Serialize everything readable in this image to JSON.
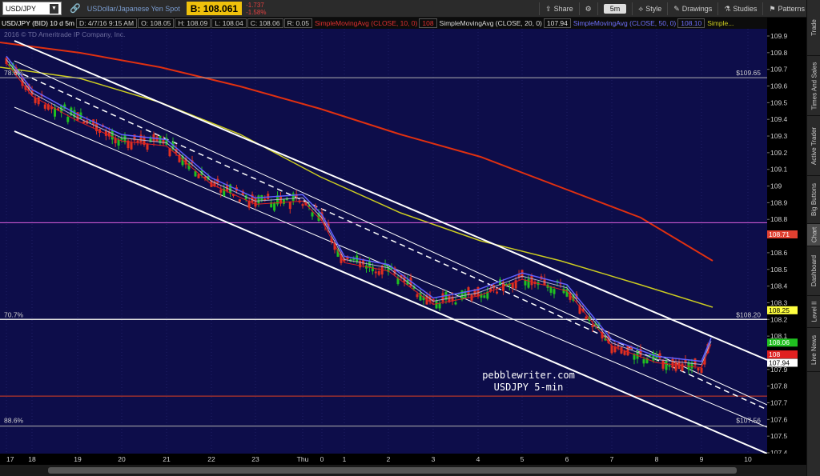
{
  "toolbar": {
    "symbol": "USD/JPY",
    "description": "USDollar/Japanese Yen Spot",
    "bid_label": "B: 108.061",
    "change": "-1.737",
    "change_pct": "-1.58%",
    "share": "Share",
    "timeframe": "5m",
    "style": "Style",
    "drawings": "Drawings",
    "studies": "Studies",
    "patterns": "Patterns"
  },
  "study_line": {
    "instrument": "USD/JPY (BID) 10 d 5m",
    "date": "D: 4/7/16 9:15 AM",
    "open": "O: 108.05",
    "high": "H: 108.09",
    "low": "L: 108.04",
    "close": "C: 108.06",
    "range": "R: 0.05",
    "sma10": "SimpleMovingAvg (CLOSE, 10, 0)",
    "sma10_val": "108",
    "sma20": "SimpleMovingAvg (CLOSE, 20, 0)",
    "sma20_val": "107.94",
    "sma50": "SimpleMovingAvg (CLOSE, 50, 0)",
    "sma50_val": "108.10",
    "sma_more": "Simple..."
  },
  "copyright": "2016 © TD Ameritrade IP Company, Inc.",
  "watermark": [
    "pebblewriter.com",
    "USDJPY 5-min"
  ],
  "fib_labels": {
    "f786": "78.6%",
    "f707": "70.7%",
    "f886": "88.6%",
    "p10965": "$109.65",
    "p10820": "$108.20",
    "p10756": "$107.56"
  },
  "price_tags": {
    "magenta": "108.71",
    "yellow": "108.25",
    "green": "108.06",
    "red": "108",
    "white": "107.94"
  },
  "colors": {
    "background": "#0d0d4a",
    "sma10": "#e02020",
    "sma20": "#b0b0d0",
    "sma50": "#6060ff",
    "sma100": "#cccc20",
    "sma200": "#e03010",
    "magenta_line": "#e060e0",
    "channel": "#ffffff",
    "up_candle": "#20c020",
    "down_candle": "#e03020"
  },
  "chart_data": {
    "type": "candlestick",
    "symbol": "USD/JPY",
    "interval": "5m",
    "ylim": [
      107.4,
      110.0
    ],
    "y_ticks": [
      "109.9",
      "109.8",
      "109.7",
      "109.6",
      "109.5",
      "109.4",
      "109.3",
      "109.2",
      "109.1",
      "109",
      "108.9",
      "108.8",
      "108.7",
      "108.6",
      "108.5",
      "108.4",
      "108.3",
      "108.2",
      "108.1",
      "108",
      "107.9",
      "107.8",
      "107.7",
      "107.6",
      "107.5",
      "107.4"
    ],
    "x_ticks": [
      "17",
      "18",
      "19",
      "20",
      "21",
      "22",
      "23",
      "Thu",
      "0",
      "1",
      "2",
      "3",
      "4",
      "5",
      "6",
      "7",
      "8",
      "9",
      "10"
    ],
    "horizontal_levels": [
      {
        "label": "78.6%",
        "value": 109.65
      },
      {
        "label": "70.7%",
        "value": 108.2
      },
      {
        "label": "88.6%",
        "value": 107.56
      },
      {
        "value": 108.78
      },
      {
        "value": 107.74
      }
    ],
    "close_path": [
      [
        "17",
        109.75
      ],
      [
        "18",
        109.55
      ],
      [
        "19",
        109.4
      ],
      [
        "20",
        109.28
      ],
      [
        "21",
        109.25
      ],
      [
        "22",
        109.02
      ],
      [
        "23",
        108.9
      ],
      [
        "Thu",
        108.92
      ],
      [
        "0",
        108.8
      ],
      [
        "1",
        108.55
      ],
      [
        "2",
        108.5
      ],
      [
        "3",
        108.3
      ],
      [
        "4",
        108.35
      ],
      [
        "5",
        108.45
      ],
      [
        "6",
        108.38
      ],
      [
        "7",
        108.05
      ],
      [
        "8",
        107.95
      ],
      [
        "9",
        107.92
      ],
      [
        "9.5",
        108.06
      ]
    ]
  }
}
